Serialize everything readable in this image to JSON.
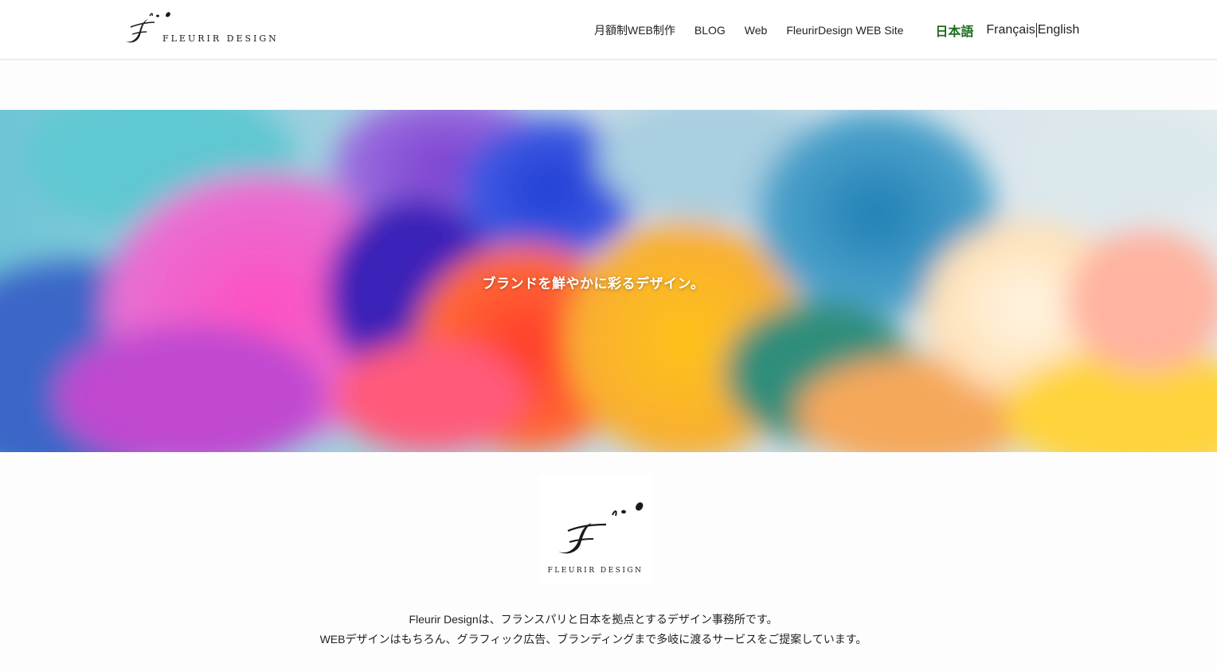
{
  "header": {
    "logo": {
      "mark": "F",
      "text": "FLEURIR DESIGN"
    },
    "nav": [
      {
        "label": "月額制WEB制作"
      },
      {
        "label": "BLOG"
      },
      {
        "label": "Web"
      },
      {
        "label": "FleurirDesign WEB Site"
      }
    ],
    "languages": {
      "japanese": "日本語",
      "french": "Français",
      "english": "English",
      "active_color": "#1e6b1e"
    }
  },
  "hero": {
    "tagline": "ブランドを鮮やかに彩るデザイン。"
  },
  "about": {
    "logo": {
      "mark": "F",
      "text": "FLEURIR DESIGN"
    },
    "line1": "Fleurir Designは、フランスパリと日本を拠点とするデザイン事務所です。",
    "line2": "WEBデザインはもちろん、グラフィック広告、ブランディングまで多岐に渡るサービスをご提案しています。"
  }
}
